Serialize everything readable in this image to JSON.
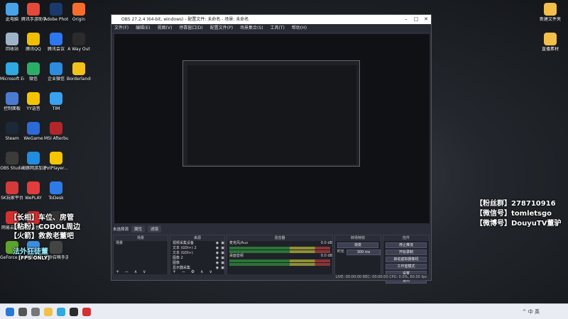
{
  "desktop": {
    "icons_left": [
      {
        "label": "此电脑",
        "color": "#4aa3e6"
      },
      {
        "label": "回收站",
        "color": "#9fb3c8"
      },
      {
        "label": "Microsoft Edge",
        "color": "#2fa9e0"
      },
      {
        "label": "控制面板",
        "color": "#4b7bd1"
      },
      {
        "label": "Steam",
        "color": "#1b2838"
      },
      {
        "label": "OBS Studio",
        "color": "#3b3b3b"
      },
      {
        "label": "SK玩家平台",
        "color": "#d43a3a"
      },
      {
        "label": "网易云音乐",
        "color": "#d33131"
      },
      {
        "label": "GeForce Experience",
        "color": "#5ea32c"
      }
    ],
    "icons_col2": [
      {
        "label": "腾讯手游助手",
        "color": "#e6493a"
      },
      {
        "label": "腾讯QQ",
        "color": "#f0c000"
      },
      {
        "label": "微信",
        "color": "#2aae67"
      },
      {
        "label": "YY语音",
        "color": "#f5c400"
      },
      {
        "label": "WeGame",
        "color": "#2b6ad8"
      },
      {
        "label": "海豚网游加速器5.0",
        "color": "#1f8de0"
      },
      {
        "label": "WePLAY",
        "color": "#e23c3c"
      },
      {
        "label": "网易云音乐",
        "color": "#cf2c2c"
      },
      {
        "label": "网易云游",
        "color": "#3c8dde"
      }
    ],
    "icons_col3": [
      {
        "label": "Adobe Photosh...",
        "color": "#1b3a6b"
      },
      {
        "label": "腾讯会议",
        "color": "#2d77f0"
      },
      {
        "label": "企业微信",
        "color": "#2d8be0"
      },
      {
        "label": "TIM",
        "color": "#3aa0f0"
      },
      {
        "label": "MSI Afterburner",
        "color": "#b3262a"
      },
      {
        "label": "PotPlayer...",
        "color": "#f5c500"
      },
      {
        "label": "ToDesk",
        "color": "#2e7be6"
      },
      {
        "label": "",
        "color": "#333"
      },
      {
        "label": "使命召唤手游",
        "color": "#444"
      }
    ],
    "icons_col4": [
      {
        "label": "Origin",
        "color": "#f56c2d"
      },
      {
        "label": "A Way Out",
        "color": "#2b2b2b"
      },
      {
        "label": "Borderlands 3",
        "color": "#f3c21a"
      }
    ],
    "icons_right": [
      {
        "label": "新建文件夹",
        "color": "#f2c04a"
      },
      {
        "label": "直播素材",
        "color": "#f2c04a"
      }
    ]
  },
  "overlay": {
    "fans_group": "【粉丝群】278710916",
    "wechat": "【微信号】tomletsgo",
    "weibo": "【微博号】DouyuTV董驴",
    "left_line1": "【长相】车位、房管",
    "left_line2": "【粘粉】CODOL周边",
    "left_line3": "【火箭】救救老董吧",
    "brand": "法外狂徒董",
    "fps": "[FPS ONLY]"
  },
  "obs": {
    "title": "OBS 27.2.4 (64-bit, windows) - 配置文件: 未命名 - 场景: 未命名",
    "menu": [
      "文件(F)",
      "编辑(E)",
      "视图(V)",
      "停靠窗口(D)",
      "配置文件(P)",
      "场景集合(S)",
      "工具(T)",
      "帮助(H)"
    ],
    "source_bar_label": "未选择源",
    "source_bar_btn1": "属性",
    "source_bar_btn2": "滤镜",
    "panels": {
      "scenes_title": "场景",
      "scenes": [
        "场景"
      ],
      "sources_title": "来源",
      "sources": [
        "视频采集设备",
        "文本 (GDI+) 2",
        "文本 (GDI+)",
        "图像 2",
        "图像",
        "显示器采集"
      ],
      "mixer_title": "混音器",
      "mixer_tracks": [
        {
          "name": "麦克风/Aux",
          "db": "0.0 dB"
        },
        {
          "name": "桌面音频",
          "db": "0.0 dB"
        }
      ],
      "transitions_title": "转场特效",
      "transition_value": "渐变",
      "duration_label": "时长",
      "duration_value": "300 ms",
      "controls_title": "控件",
      "controls": [
        "停止推流",
        "开始录制",
        "启动虚拟摄像机",
        "工作室模式",
        "设置",
        "退出"
      ]
    },
    "status": "LIVE: 00:00:00   REC: 00:00:00   CPU: 0.0%, 60.00 fps"
  },
  "taskbar": {
    "time": "",
    "tray_text": "^  中  英"
  }
}
